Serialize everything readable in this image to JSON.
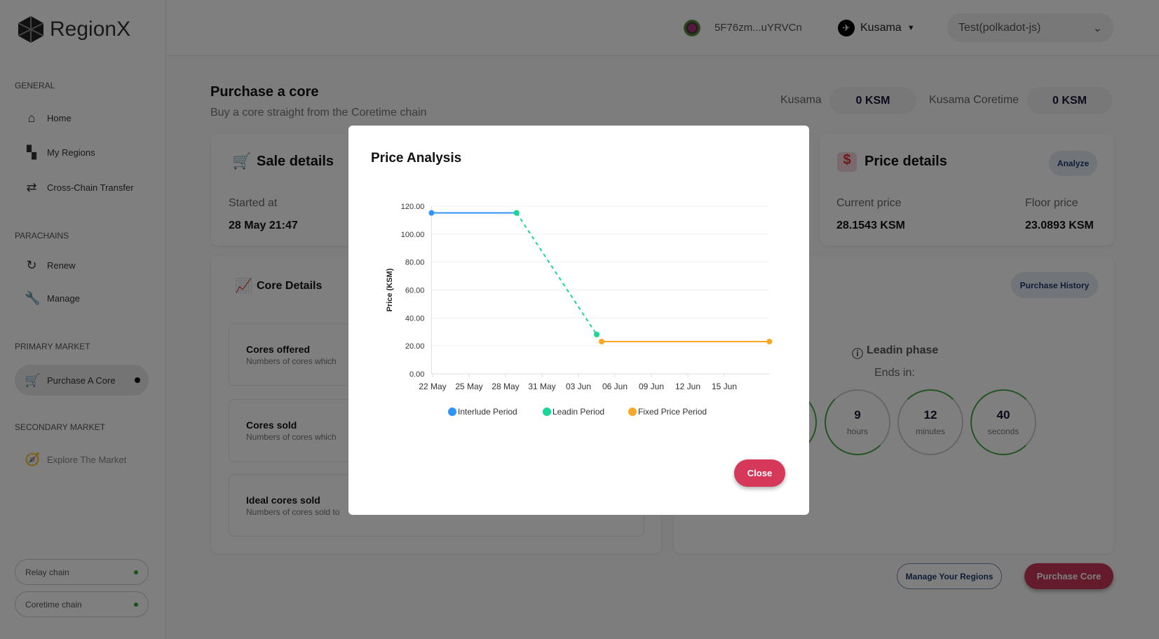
{
  "app": {
    "name": "RegionX"
  },
  "header": {
    "address": "5F76zm...uYRVCn",
    "network": "Kusama",
    "wallet": "Test(polkadot-js)"
  },
  "sidebar": {
    "sections": [
      {
        "title": "GENERAL",
        "items": [
          {
            "label": "Home",
            "icon": "home-icon"
          },
          {
            "label": "My Regions",
            "icon": "dashboard-icon"
          },
          {
            "label": "Cross-Chain Transfer",
            "icon": "swap-icon"
          }
        ]
      },
      {
        "title": "PARACHAINS",
        "items": [
          {
            "label": "Renew",
            "icon": "renew-icon"
          },
          {
            "label": "Manage",
            "icon": "wrench-icon"
          }
        ]
      },
      {
        "title": "PRIMARY MARKET",
        "items": [
          {
            "label": "Purchase A Core",
            "icon": "cart-icon",
            "active": true
          }
        ]
      },
      {
        "title": "SECONDARY MARKET",
        "items": [
          {
            "label": "Explore The Market",
            "icon": "compass-icon"
          }
        ]
      }
    ],
    "chains": [
      {
        "label": "Relay chain",
        "status": "connected"
      },
      {
        "label": "Coretime chain",
        "status": "connected"
      }
    ]
  },
  "page": {
    "title": "Purchase a core",
    "subtitle": "Buy a core straight from the Coretime chain",
    "balances": [
      {
        "label": "Kusama",
        "value": "0 KSM"
      },
      {
        "label": "Kusama Coretime",
        "value": "0 KSM"
      }
    ]
  },
  "sale": {
    "title": "Sale details",
    "started_label": "Started at",
    "started_value": "28 May 21:47"
  },
  "price": {
    "title": "Price details",
    "analyze": "Analyze",
    "current_label": "Current price",
    "current_value": "28.1543 KSM",
    "floor_label": "Floor price",
    "floor_value": "23.0893 KSM"
  },
  "core": {
    "title": "Core Details",
    "items": [
      {
        "title": "Cores offered",
        "desc": "Numbers of cores which"
      },
      {
        "title": "Cores sold",
        "desc": "Numbers of cores which"
      },
      {
        "title": "Ideal cores sold",
        "desc": "Numbers of cores sold to"
      }
    ]
  },
  "phase": {
    "history": "Purchase History",
    "name": "Leadin phase",
    "ends": "Ends in:",
    "countdown": [
      {
        "value": "9",
        "unit": "hours"
      },
      {
        "value": "12",
        "unit": "minutes"
      },
      {
        "value": "40",
        "unit": "seconds"
      }
    ]
  },
  "actions": {
    "manage": "Manage Your Regions",
    "purchase": "Purchase Core"
  },
  "modal": {
    "title": "Price Analysis",
    "close": "Close"
  },
  "chart_data": {
    "type": "line",
    "title": "",
    "xlabel": "",
    "ylabel": "Price (KSM)",
    "ylim": [
      0,
      120
    ],
    "yticks": [
      "0.00",
      "20.00",
      "40.00",
      "60.00",
      "80.00",
      "100.00",
      "120.00"
    ],
    "xticks": [
      "22 May",
      "25 May",
      "28 May",
      "31 May",
      "03 Jun",
      "06 Jun",
      "09 Jun",
      "12 Jun",
      "15 Jun"
    ],
    "grid": true,
    "legend": "bottom",
    "series": [
      {
        "name": "Interlude Period",
        "color": "#2e93fa",
        "dashed": false,
        "points": [
          [
            "21 May 21:47",
            115.2
          ],
          [
            "28 May 21:47",
            115.2
          ]
        ]
      },
      {
        "name": "Leadin Period",
        "color": "#1ad598",
        "dashed": true,
        "points": [
          [
            "28 May 21:47",
            115.2
          ],
          [
            "04 Jun 12:00",
            28.1543
          ]
        ]
      },
      {
        "name": "Fixed Price Period",
        "color": "#f9a825",
        "dashed": false,
        "points": [
          [
            "04 Jun 21:47",
            23.0893
          ],
          [
            "18 Jun 17:00",
            23.0893
          ]
        ]
      }
    ]
  }
}
